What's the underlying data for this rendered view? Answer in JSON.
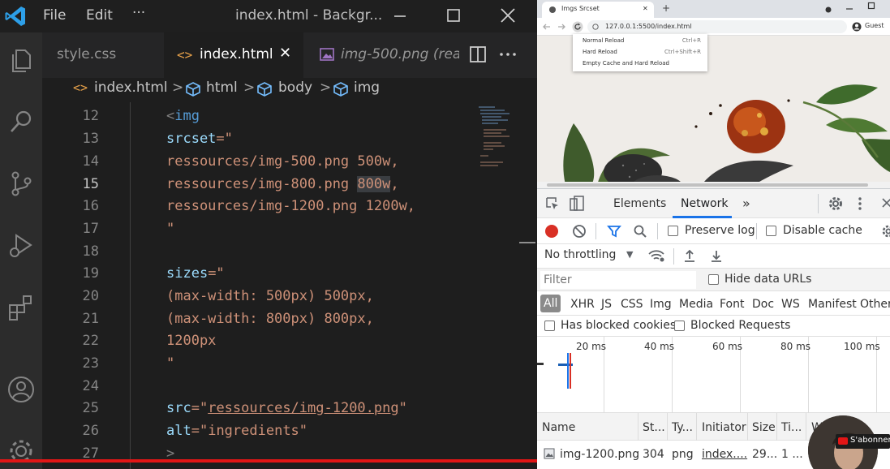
{
  "vscode": {
    "menu": [
      "File",
      "Edit",
      "···"
    ],
    "window_title": "index.html - Backgr...",
    "tabs": [
      {
        "label": "style.css",
        "active": false
      },
      {
        "label": "index.html",
        "active": true,
        "close": "✕"
      },
      {
        "label": "img-500.png (read",
        "active": false
      }
    ],
    "breadcrumb": [
      "index.html",
      "html",
      "body",
      "img"
    ],
    "lines": [
      "12",
      "13",
      "14",
      "15",
      "16",
      "17",
      "18",
      "19",
      "20",
      "21",
      "22",
      "23",
      "24",
      "25",
      "26",
      "27"
    ],
    "current_line": "15",
    "code": {
      "l12_tag": "<img",
      "l13_attr": "srcset",
      "l13_eq": "=\"",
      "l14": "ressources/img-500.png 500w,",
      "l15_a": "ressources/img-800.png ",
      "l15_hl": "800w",
      "l15_b": ",",
      "l16": "ressources/img-1200.png 1200w,",
      "l17": "\"",
      "l19_attr": "sizes",
      "l19_eq": "=\"",
      "l20": "(max-width: 500px) 500px,",
      "l21": "(max-width: 800px) 800px,",
      "l22": "1200px",
      "l23": "\"",
      "l25_attr": "src",
      "l25_eq": "=\"",
      "l25_val": "ressources/img-1200.png",
      "l25_end": "\"",
      "l26_attr": "alt",
      "l26_eq": "=\"",
      "l26_val": "ingredients",
      "l26_end": "\"",
      "l27": ">"
    },
    "colors": {
      "accent_blue": "#0098ff",
      "tag": "#569cd6",
      "attr": "#9cdcfe",
      "string": "#ce9178",
      "progress": "#e21616"
    }
  },
  "chrome": {
    "tab_title": "Imgs Srcset",
    "tab_close": "✕",
    "new_tab": "+",
    "url": "127.0.0.1:5500/index.html",
    "profile": "Guest",
    "reload_menu": [
      {
        "label": "Normal Reload",
        "shortcut": "Ctrl+R"
      },
      {
        "label": "Hard Reload",
        "shortcut": "Ctrl+Shift+R"
      },
      {
        "label": "Empty Cache and Hard Reload",
        "shortcut": ""
      }
    ]
  },
  "devtools": {
    "tabs": [
      "Elements",
      "Network",
      "»"
    ],
    "active_tab": "Network",
    "preserve_log": "Preserve log",
    "disable_cache": "Disable cache",
    "throttling": "No throttling",
    "filter_placeholder": "Filter",
    "hide_data_urls": "Hide data URLs",
    "types": [
      "All",
      "XHR",
      "JS",
      "CSS",
      "Img",
      "Media",
      "Font",
      "Doc",
      "WS",
      "Manifest",
      "Other"
    ],
    "has_blocked_cookies": "Has blocked cookies",
    "blocked_requests": "Blocked Requests",
    "timeline_ticks": [
      "20 ms",
      "40 ms",
      "60 ms",
      "80 ms",
      "100 ms"
    ],
    "columns": [
      "Name",
      "St...",
      "Ty...",
      "Initiator",
      "Size",
      "Ti...",
      "W"
    ],
    "rows": [
      {
        "name": "img-1200.png",
        "status": "304",
        "type": "png",
        "initiator": "index....",
        "size": "29...",
        "time": "1 ..."
      }
    ]
  },
  "overlay": {
    "subscribe": "S'abonner"
  }
}
